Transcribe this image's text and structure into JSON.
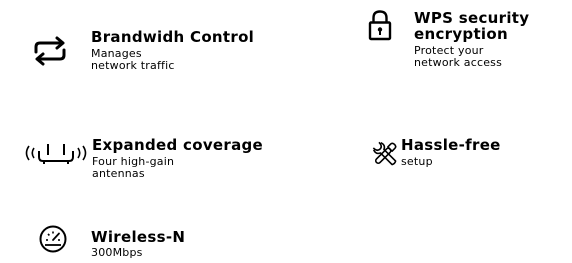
{
  "features": [
    {
      "id": "bandwidth",
      "icon": "swap-arrows-icon",
      "title": "Brandwidh Control",
      "desc_lines": [
        "Manages",
        "network traffic"
      ]
    },
    {
      "id": "wps",
      "icon": "padlock-icon",
      "title_lines": [
        "WPS security",
        "encryption"
      ],
      "desc_lines": [
        "Protect your",
        "network access"
      ]
    },
    {
      "id": "coverage",
      "icon": "router-antenna-icon",
      "title": "Expanded coverage",
      "desc_lines": [
        "Four high-gain",
        "antennas"
      ]
    },
    {
      "id": "hassle",
      "icon": "tools-icon",
      "title": "Hassle-free",
      "desc_lines": [
        "setup"
      ]
    },
    {
      "id": "wireless",
      "icon": "speedometer-icon",
      "title": "Wireless-N",
      "desc_lines": [
        "300Mbps"
      ]
    }
  ]
}
